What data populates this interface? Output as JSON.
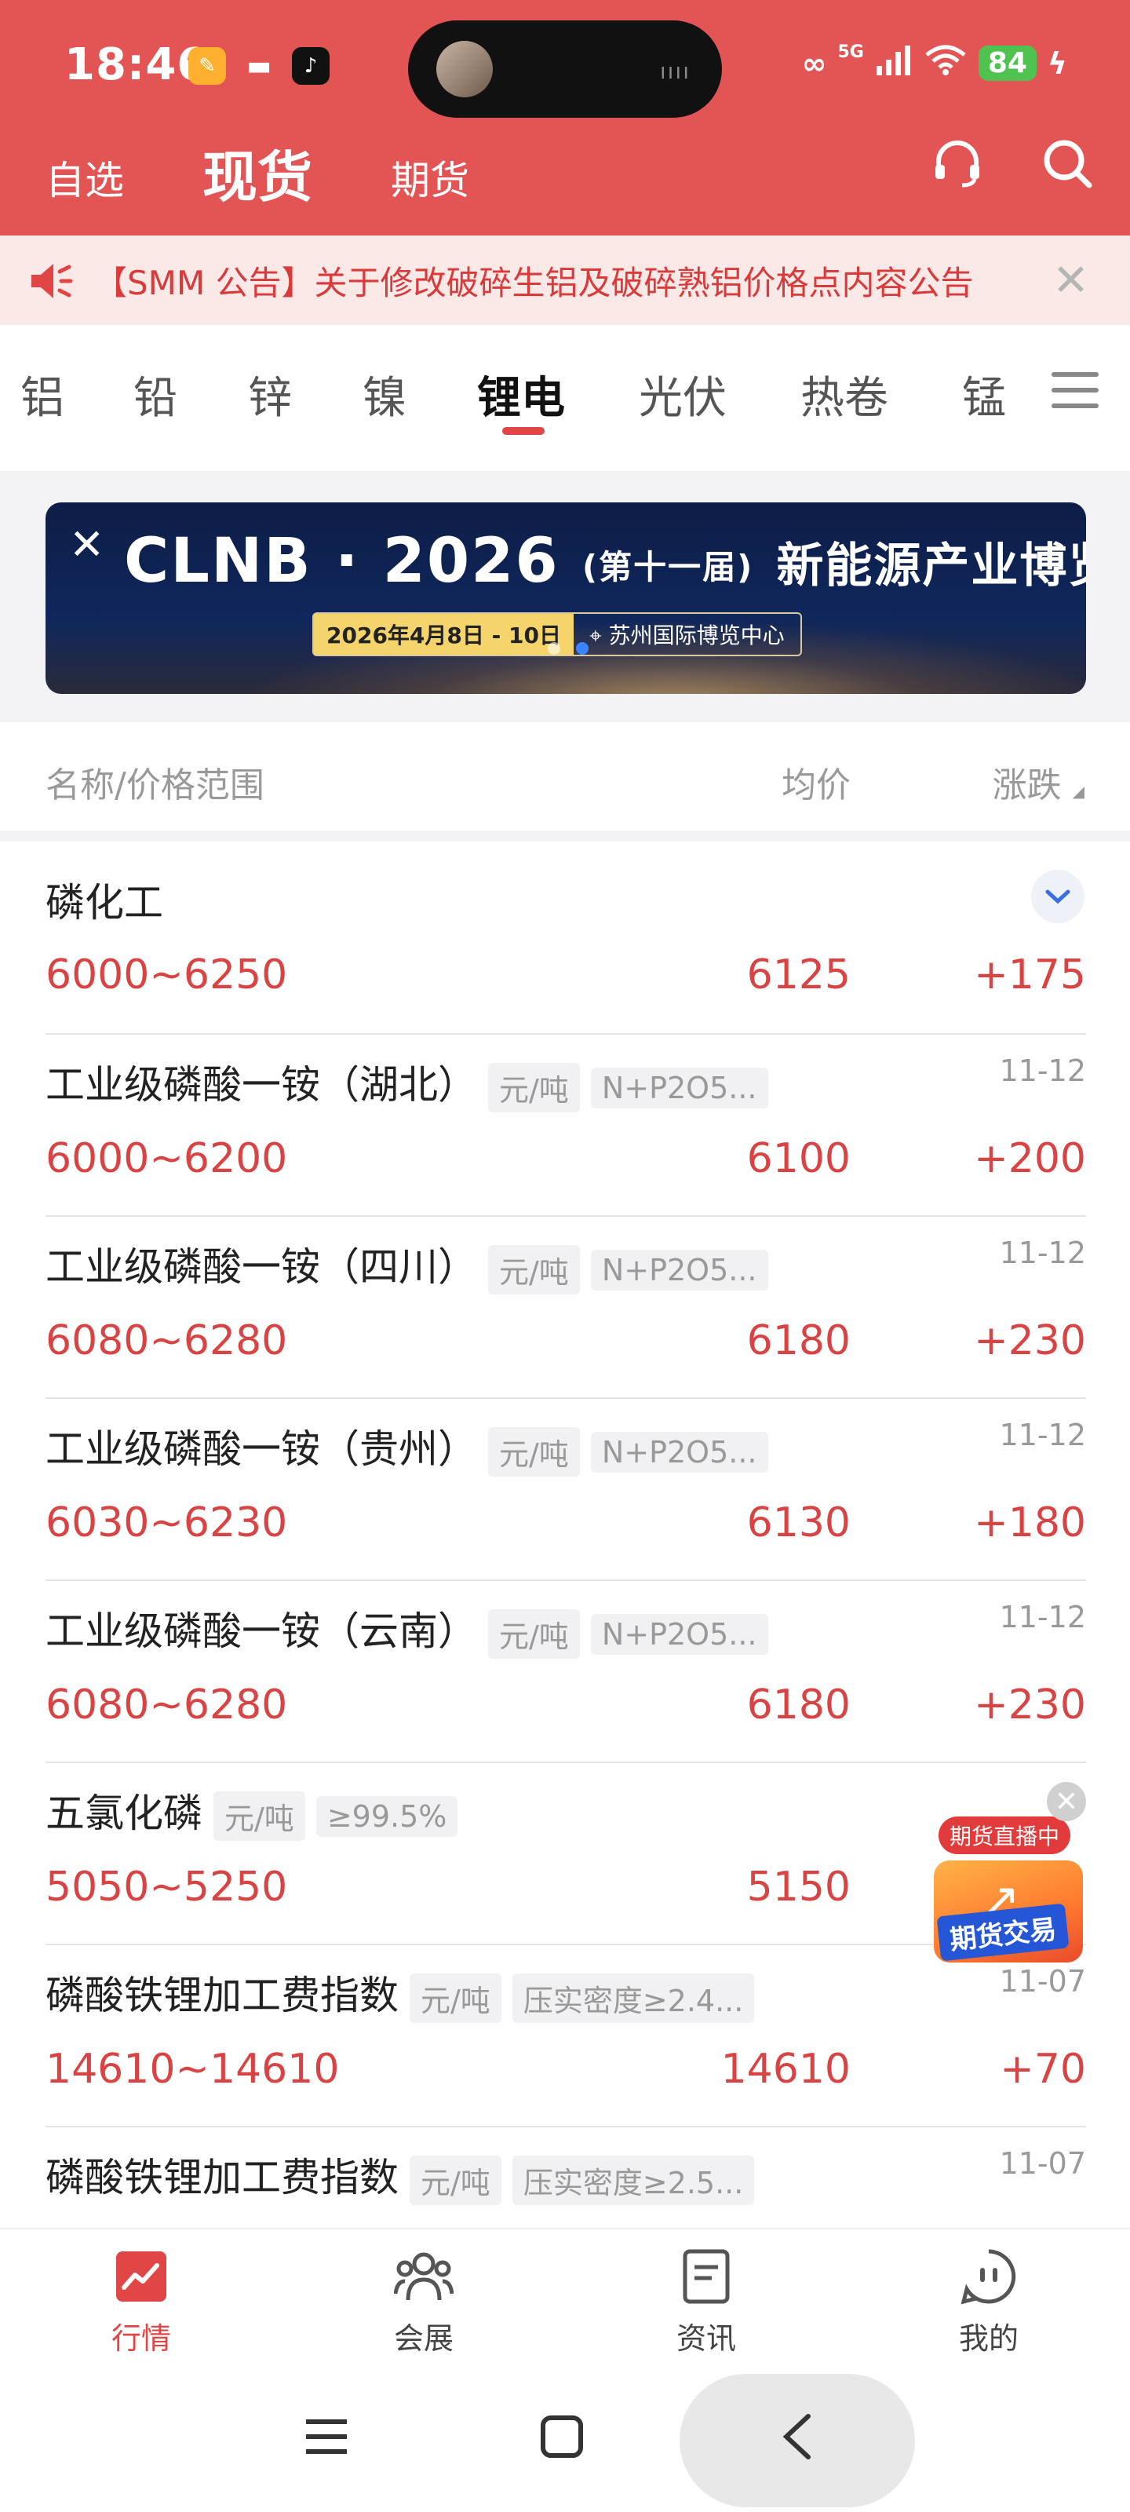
{
  "status_bar": {
    "time": "18:46",
    "battery": "84",
    "network": "5G"
  },
  "top_nav": {
    "tabs": [
      {
        "label": "自选"
      },
      {
        "label": "现货"
      },
      {
        "label": "期货"
      }
    ],
    "active_tab": "现货",
    "icons": [
      "headset-icon",
      "search-icon"
    ]
  },
  "notice": {
    "text": "【SMM 公告】关于修改破碎生铝及破碎熟铝价格点内容公告"
  },
  "categories": {
    "tabs": [
      "铝",
      "铅",
      "锌",
      "镍",
      "锂电",
      "光伏",
      "热卷",
      "锰"
    ],
    "active": "锂电"
  },
  "banner": {
    "title_prefix": "CLNB · 2",
    "title_year": "026",
    "edition": "(第十一届)",
    "subject": "新能源产业博览会",
    "date": "2026年4月8日 - 10日",
    "venue": "苏州国际博览中心"
  },
  "list_header": {
    "name": "名称/价格范围",
    "avg": "均价",
    "change": "涨跌"
  },
  "group": {
    "title": "磷化工"
  },
  "items": [
    {
      "name": "",
      "unit": "",
      "spec": "",
      "date": "",
      "range": "6000~6250",
      "avg": "6125",
      "change": "+175"
    },
    {
      "name": "工业级磷酸一铵（湖北）",
      "unit": "元/吨",
      "spec": "N+P2O5...",
      "date": "11-12",
      "range": "6000~6200",
      "avg": "6100",
      "change": "+200"
    },
    {
      "name": "工业级磷酸一铵（四川）",
      "unit": "元/吨",
      "spec": "N+P2O5...",
      "date": "11-12",
      "range": "6080~6280",
      "avg": "6180",
      "change": "+230"
    },
    {
      "name": "工业级磷酸一铵（贵州）",
      "unit": "元/吨",
      "spec": "N+P2O5...",
      "date": "11-12",
      "range": "6030~6230",
      "avg": "6130",
      "change": "+180"
    },
    {
      "name": "工业级磷酸一铵（云南）",
      "unit": "元/吨",
      "spec": "N+P2O5...",
      "date": "11-12",
      "range": "6080~6280",
      "avg": "6180",
      "change": "+230"
    },
    {
      "name": "五氯化磷",
      "unit": "元/吨",
      "spec": "≥99.5%",
      "date": "",
      "range": "5050~5250",
      "avg": "5150",
      "change": ""
    },
    {
      "name": "磷酸铁锂加工费指数",
      "unit": "元/吨",
      "spec": "压实密度≥2.4...",
      "date": "11-07",
      "range": "14610~14610",
      "avg": "14610",
      "change": "+70"
    },
    {
      "name": "磷酸铁锂加工费指数",
      "unit": "元/吨",
      "spec": "压实密度≥2.5...",
      "date": "11-07",
      "range": "",
      "avg": "",
      "change": ""
    }
  ],
  "promo": {
    "live_label": "期货直播中",
    "main_label": "期货交易"
  },
  "bottom_nav": {
    "items": [
      {
        "label": "行情"
      },
      {
        "label": "会展"
      },
      {
        "label": "资讯"
      },
      {
        "label": "我的"
      }
    ],
    "active": "行情"
  },
  "colors": {
    "brand_red": "#e35555",
    "price_red": "#d84444",
    "notice_bg": "#fbe9e8"
  }
}
